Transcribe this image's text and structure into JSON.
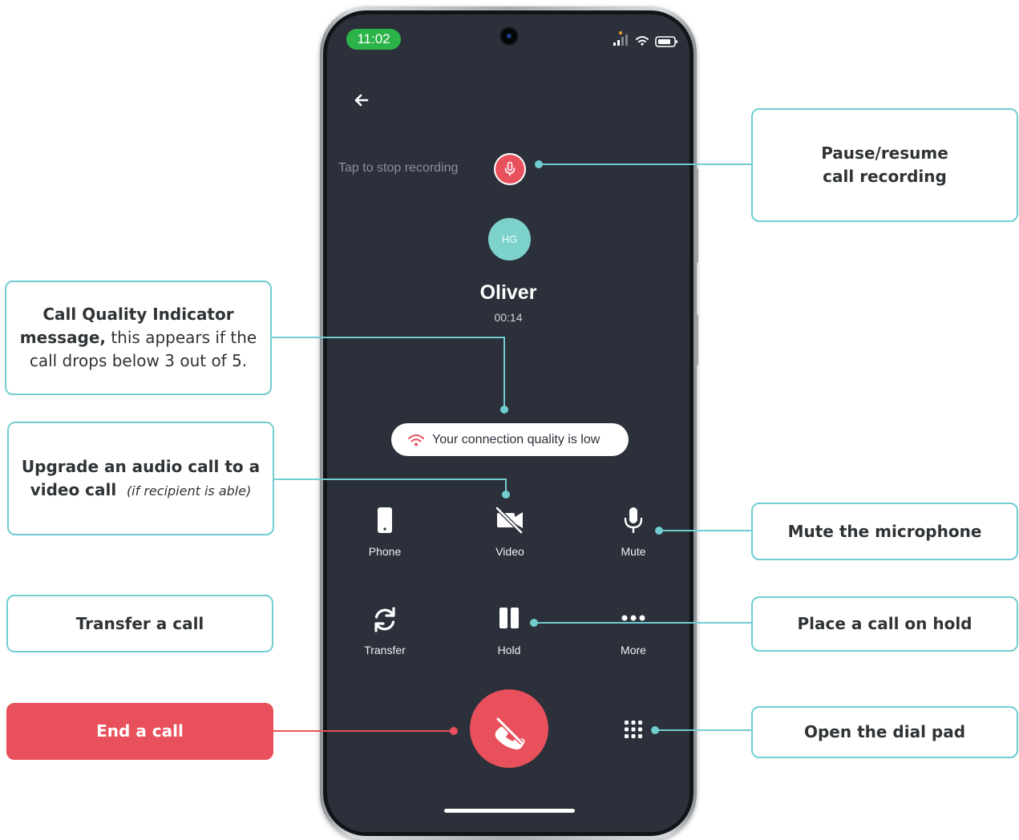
{
  "status_bar": {
    "time": "11:02"
  },
  "recording": {
    "hint": "Tap to stop recording"
  },
  "caller": {
    "initials": "HG",
    "name": "Oliver",
    "duration": "00:14"
  },
  "quality_banner": {
    "message": "Your connection quality is low",
    "icon": "wifi-icon",
    "icon_color": "#e8505b"
  },
  "controls": {
    "phone": {
      "label": "Phone",
      "icon": "phone-device-icon"
    },
    "video": {
      "label": "Video",
      "icon": "video-off-icon"
    },
    "mute": {
      "label": "Mute",
      "icon": "microphone-icon"
    },
    "transfer": {
      "label": "Transfer",
      "icon": "refresh-icon"
    },
    "hold": {
      "label": "Hold",
      "icon": "pause-icon"
    },
    "more": {
      "label": "More",
      "icon": "more-dots-icon"
    },
    "end_call": {
      "icon": "end-call-icon",
      "color": "#e8505b"
    },
    "dialpad": {
      "icon": "dialpad-icon"
    }
  },
  "callouts": {
    "recording": {
      "line1": "Pause/resume",
      "line2": "call recording"
    },
    "quality": {
      "bold1": "Call Quality Indicator",
      "bold2": "message,",
      "text2": " this appears if the",
      "line3": "call drops below 3 out of 5."
    },
    "video": {
      "line1": "Upgrade an audio call to a",
      "bold2": "video call",
      "italic2": "(if recipient is able)"
    },
    "mute": {
      "text": "Mute the microphone"
    },
    "transfer": {
      "text": "Transfer a call"
    },
    "hold": {
      "text": "Place a call on hold"
    },
    "end": {
      "text": "End a call"
    },
    "dialpad": {
      "text": "Open the dial pad"
    }
  },
  "colors": {
    "accent_teal": "#71cdd0",
    "end_red": "#e8505b",
    "screen_bg": "#2b303a",
    "status_green": "#2cb34a"
  }
}
